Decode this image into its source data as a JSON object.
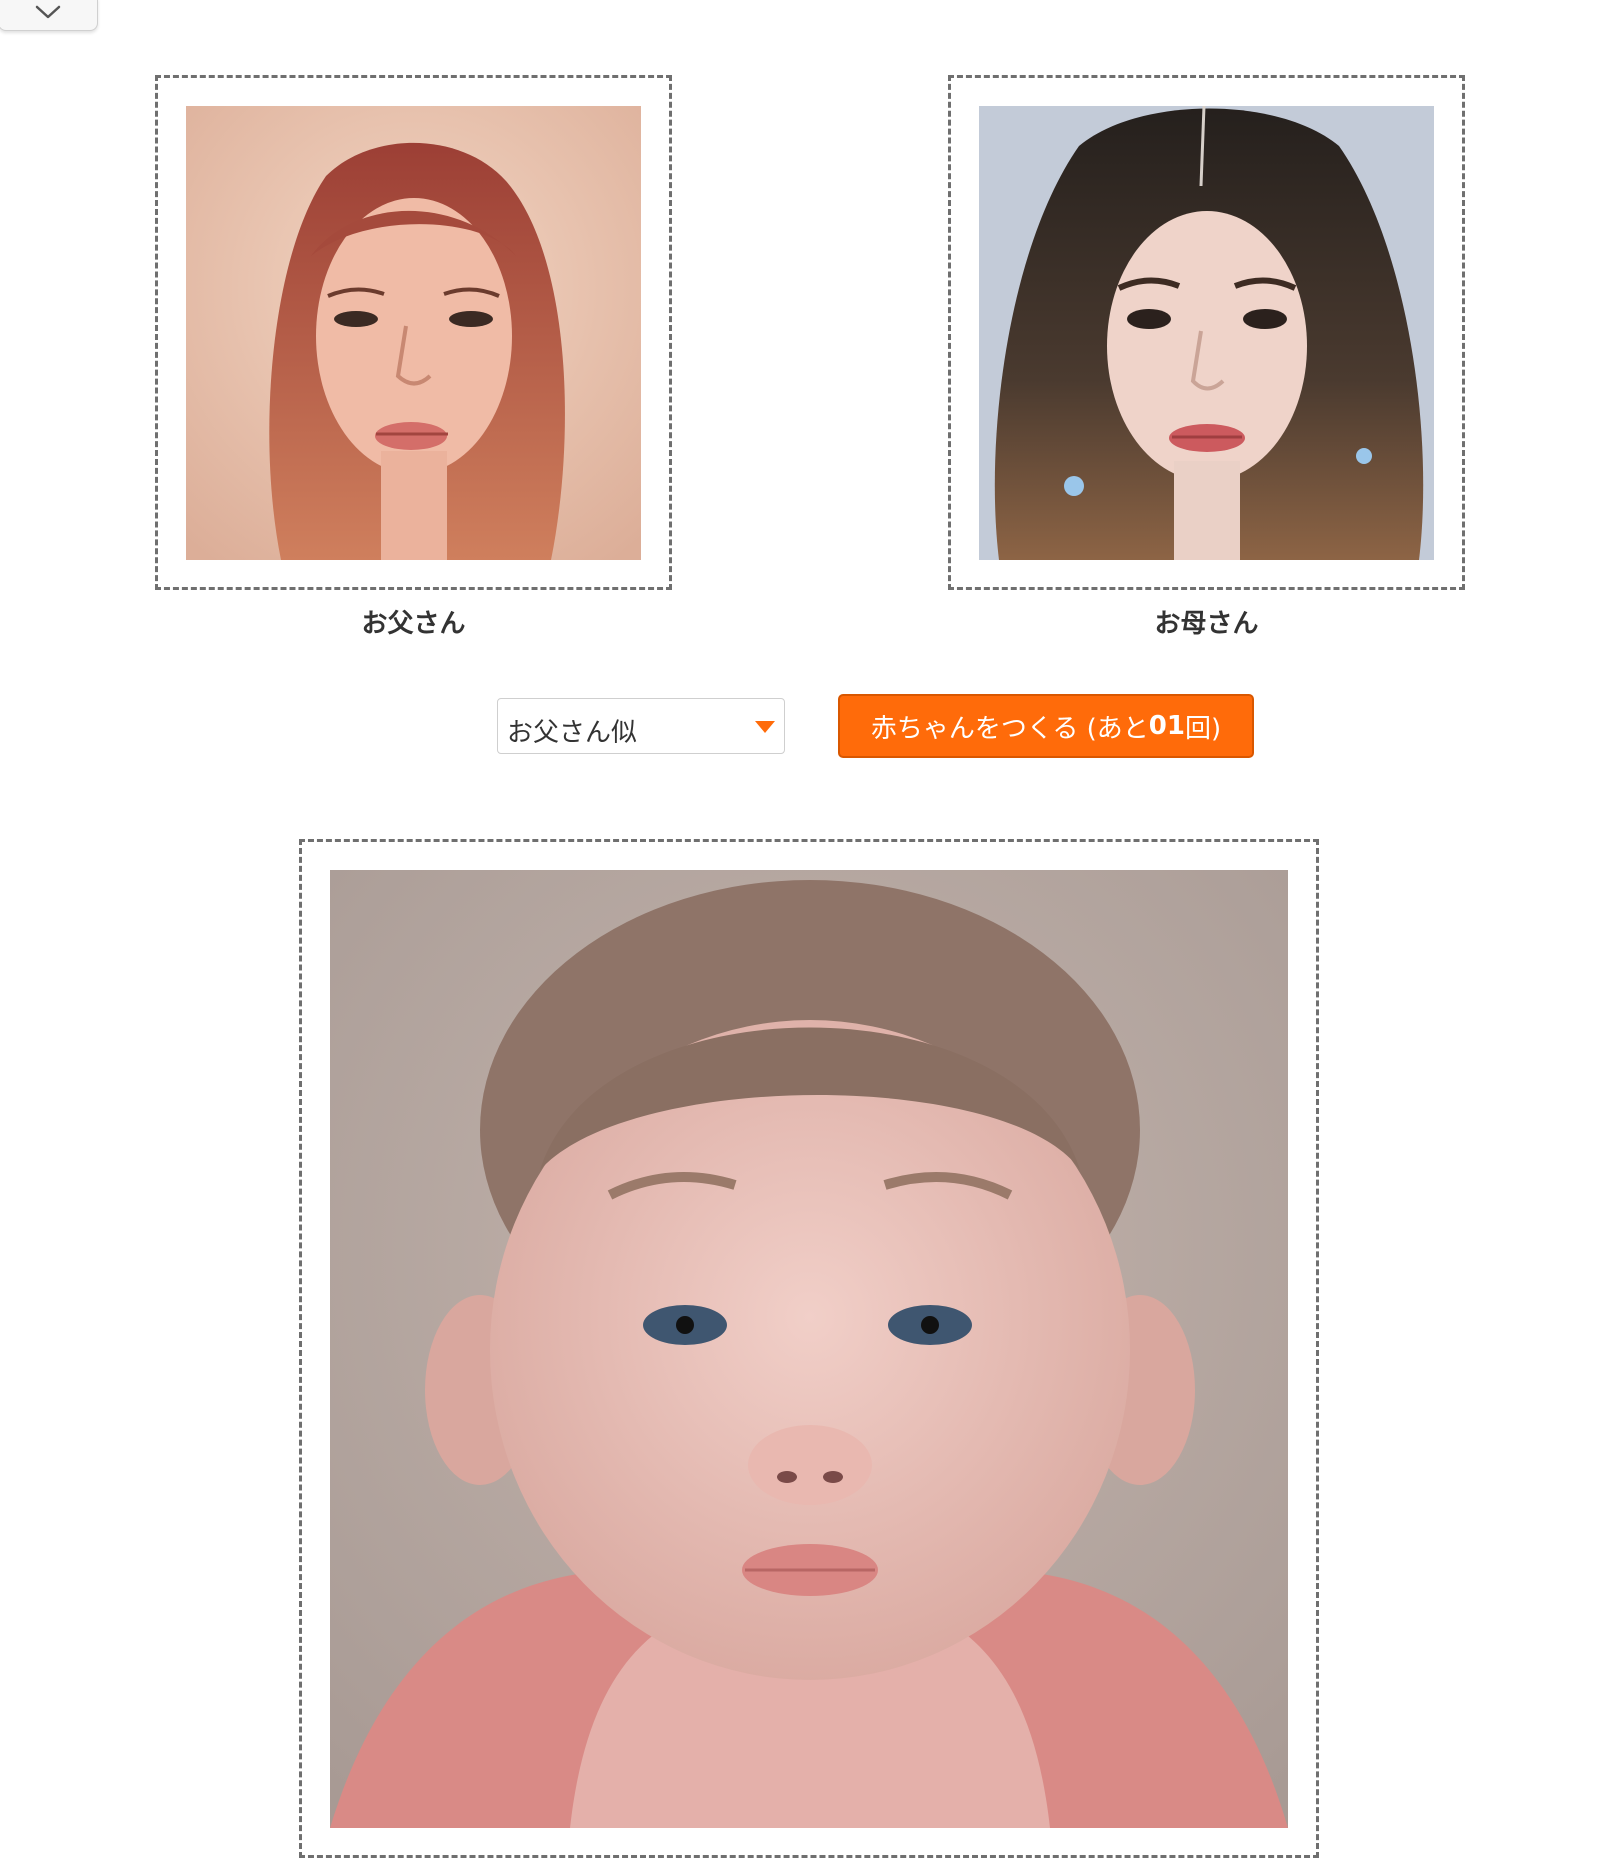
{
  "header": {
    "collapse_icon": "chevron-down-icon"
  },
  "parents": {
    "father": {
      "label": "お父さん"
    },
    "mother": {
      "label": "お母さん"
    }
  },
  "controls": {
    "similarity_select": {
      "value": "お父さん似",
      "icon": "caret-down-icon"
    },
    "make_baby_button": {
      "prefix": "赤ちゃんをつくる (あと",
      "count": "01",
      "suffix": "回)"
    }
  },
  "colors": {
    "accent": "#ff6b0a",
    "frame_border": "#6f6f6f",
    "caption_text": "#333333"
  }
}
